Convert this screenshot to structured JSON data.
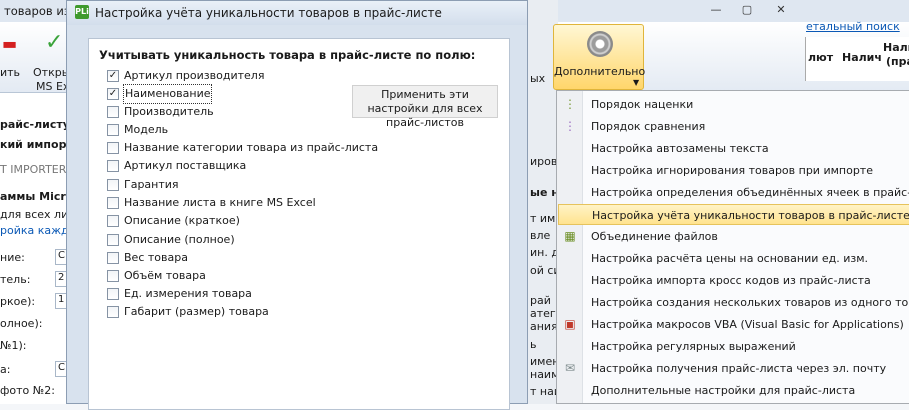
{
  "background": {
    "title_fragment": "товаров из",
    "ribbon_button_1": "ить",
    "ribbon_button_2a": "Откры",
    "ribbon_button_2b": "MS Ex",
    "left_texts": [
      "райс-листу:",
      "кий импор",
      "T IMPORTER_",
      "аммы Micro",
      "для всех лист",
      "ройка кажд",
      "ние:",
      "тель:",
      "ркое):",
      "олное):",
      "№1):",
      "а:",
      "фото №2:"
    ],
    "left_values": [
      "С",
      "2",
      "1",
      "С"
    ],
    "link_text": "етальный поиск",
    "grid_headers": [
      "лют",
      "Налич",
      "Нали",
      "(пра"
    ],
    "ribbon_small": "ых",
    "mid_texts": [
      "ирова",
      "ые н",
      "т им",
      "вле",
      "ин. д",
      "ой си",
      "рай",
      "атег",
      "ания",
      "ь",
      "имен",
      "наим",
      "т наи"
    ]
  },
  "dialog": {
    "logo": "PLi",
    "title": "Настройка учёта уникальности товаров в прайс-листе",
    "heading": "Учитывать уникальность товара в прайс-листе по полю:",
    "apply_button": "Применить эти настройки для всех прайс-листов",
    "options": [
      {
        "label": "Артикул производителя",
        "checked": true
      },
      {
        "label": "Наименование",
        "checked": true
      },
      {
        "label": "Производитель",
        "checked": false
      },
      {
        "label": "Модель",
        "checked": false
      },
      {
        "label": "Название категории товара из прайс-листа",
        "checked": false
      },
      {
        "label": "Артикул поставщика",
        "checked": false
      },
      {
        "label": "Гарантия",
        "checked": false
      },
      {
        "label": "Название листа в книге MS Excel",
        "checked": false
      },
      {
        "label": "Описание (краткое)",
        "checked": false
      },
      {
        "label": "Описание (полное)",
        "checked": false
      },
      {
        "label": "Вес товара",
        "checked": false
      },
      {
        "label": "Объём товара",
        "checked": false
      },
      {
        "label": "Ед. измерения товара",
        "checked": false
      },
      {
        "label": "Габарит (размер) товара",
        "checked": false
      }
    ]
  },
  "toolbar": {
    "more_button": "Дополнительно"
  },
  "menu": {
    "items": [
      {
        "label": "Порядок наценки",
        "icon": "markup-order-icon"
      },
      {
        "label": "Порядок сравнения",
        "icon": "compare-order-icon"
      },
      {
        "label": "Настройка автозамены текста",
        "icon": ""
      },
      {
        "label": "Настройка игнорирования товаров при импорте",
        "icon": ""
      },
      {
        "label": "Настройка определения объединённых ячеек в прайс-листе",
        "icon": ""
      },
      {
        "label": "Настройка учёта уникальности товаров в прайс-листе",
        "icon": ""
      },
      {
        "label": "Объединение файлов",
        "icon": "merge-files-icon"
      },
      {
        "label": "Настройка расчёта цены на основании ед. изм.",
        "icon": ""
      },
      {
        "label": "Настройка импорта кросс кодов из прайс-листа",
        "icon": ""
      },
      {
        "label": "Настройка создания нескольких товаров из одного товара",
        "icon": ""
      },
      {
        "label": "Настройка макросов VBA (Visual Basic for Applications)",
        "icon": "vba-macro-icon"
      },
      {
        "label": "Настройка регулярных выражений",
        "icon": ""
      },
      {
        "label": "Настройка получения прайс-листа через эл. почту",
        "icon": "email-icon"
      },
      {
        "label": "Дополнительные настройки для прайс-листа",
        "icon": ""
      }
    ],
    "highlighted_index": 5
  },
  "colors": {
    "accent_highlight": "#ffe38f",
    "dialog_bg": "#d8e2ee",
    "link": "#0a58b5"
  }
}
